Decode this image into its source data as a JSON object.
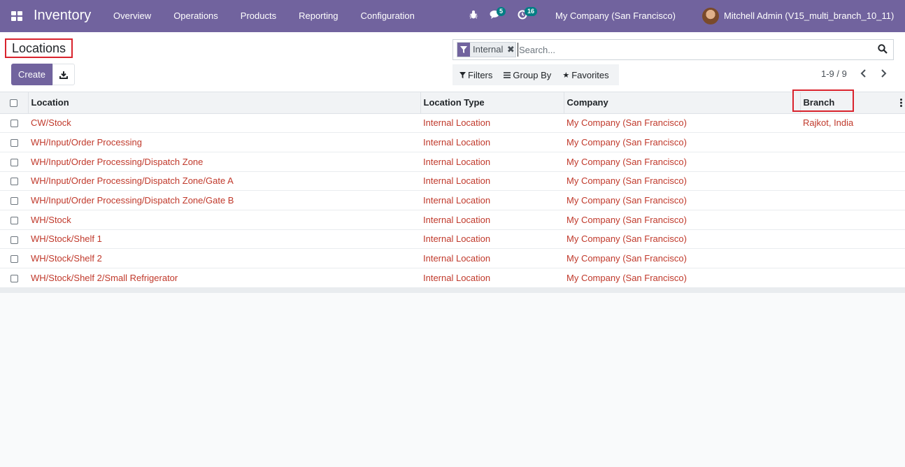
{
  "navbar": {
    "app_name": "Inventory",
    "menu": [
      "Overview",
      "Operations",
      "Products",
      "Reporting",
      "Configuration"
    ],
    "messages_count": "5",
    "activities_count": "16",
    "company": "My Company (San Francisco)",
    "user": "Mitchell Admin (V15_multi_branch_10_11)",
    "accent_color": "#71639e"
  },
  "control_panel": {
    "title": "Locations",
    "create_label": "Create",
    "search": {
      "facet_label": "Internal",
      "placeholder": "Search..."
    },
    "filters_label": "Filters",
    "group_by_label": "Group By",
    "favorites_label": "Favorites",
    "pager": "1-9 / 9"
  },
  "table": {
    "columns": [
      "Location",
      "Location Type",
      "Company",
      "Branch"
    ],
    "rows": [
      {
        "location": "CW/Stock",
        "type": "Internal Location",
        "company": "My Company (San Francisco)",
        "branch": "Rajkot, India"
      },
      {
        "location": "WH/Input/Order Processing",
        "type": "Internal Location",
        "company": "My Company (San Francisco)",
        "branch": ""
      },
      {
        "location": "WH/Input/Order Processing/Dispatch Zone",
        "type": "Internal Location",
        "company": "My Company (San Francisco)",
        "branch": ""
      },
      {
        "location": "WH/Input/Order Processing/Dispatch Zone/Gate A",
        "type": "Internal Location",
        "company": "My Company (San Francisco)",
        "branch": ""
      },
      {
        "location": "WH/Input/Order Processing/Dispatch Zone/Gate B",
        "type": "Internal Location",
        "company": "My Company (San Francisco)",
        "branch": ""
      },
      {
        "location": "WH/Stock",
        "type": "Internal Location",
        "company": "My Company (San Francisco)",
        "branch": ""
      },
      {
        "location": "WH/Stock/Shelf 1",
        "type": "Internal Location",
        "company": "My Company (San Francisco)",
        "branch": ""
      },
      {
        "location": "WH/Stock/Shelf 2",
        "type": "Internal Location",
        "company": "My Company (San Francisco)",
        "branch": ""
      },
      {
        "location": "WH/Stock/Shelf 2/Small Refrigerator",
        "type": "Internal Location",
        "company": "My Company (San Francisco)",
        "branch": ""
      }
    ]
  }
}
